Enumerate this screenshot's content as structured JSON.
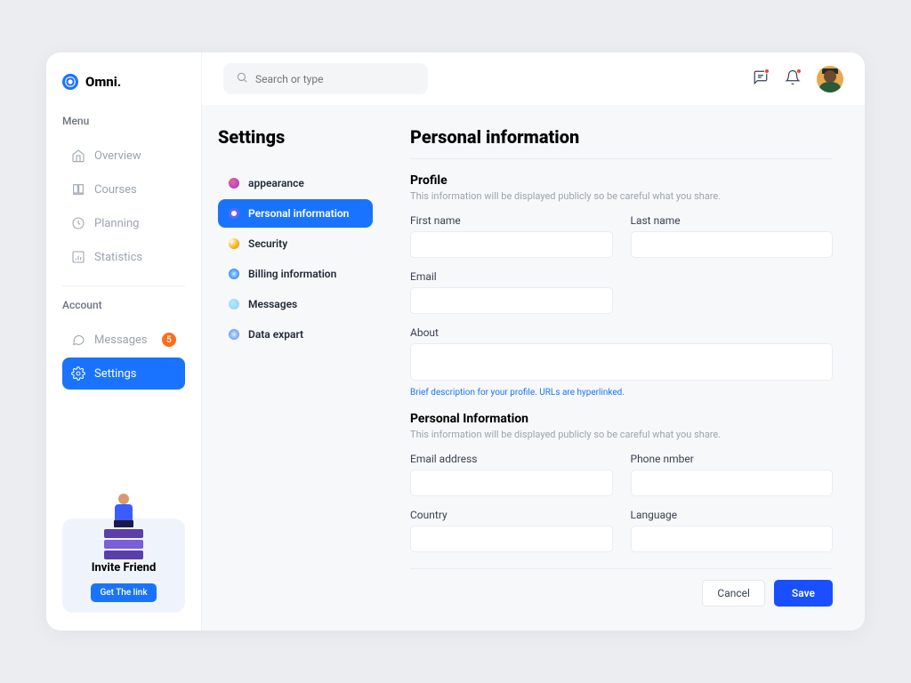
{
  "app": {
    "name": "Omni."
  },
  "search": {
    "placeholder": "Search or type"
  },
  "sidebar": {
    "menu_label": "Menu",
    "account_label": "Account",
    "menu_items": [
      {
        "label": "Overview"
      },
      {
        "label": "Courses"
      },
      {
        "label": "Planning"
      },
      {
        "label": "Statistics"
      }
    ],
    "account_items": [
      {
        "label": "Messages",
        "badge": "5"
      },
      {
        "label": "Settings"
      }
    ]
  },
  "invite": {
    "title": "Invite Friend",
    "button": "Get The link"
  },
  "settings": {
    "title": "Settings",
    "items": [
      {
        "label": "appearance"
      },
      {
        "label": "Personal information"
      },
      {
        "label": "Security"
      },
      {
        "label": "Billing information"
      },
      {
        "label": "Messages"
      },
      {
        "label": "Data expart"
      }
    ]
  },
  "panel": {
    "title": "Personal information",
    "profile": {
      "heading": "Profile",
      "desc": "This information will be displayed publicly so be careful what you share.",
      "first_name_label": "First name",
      "last_name_label": "Last name",
      "email_label": "Email",
      "about_label": "About",
      "about_hint": "Brief description for your profile. URLs are hyperlinked."
    },
    "personal": {
      "heading": "Personal Information",
      "desc": "This information will be displayed publicly so be careful what you share.",
      "email_address_label": "Email address",
      "phone_label": "Phone nmber",
      "country_label": "Country",
      "language_label": "Language"
    },
    "actions": {
      "cancel": "Cancel",
      "save": "Save"
    }
  }
}
